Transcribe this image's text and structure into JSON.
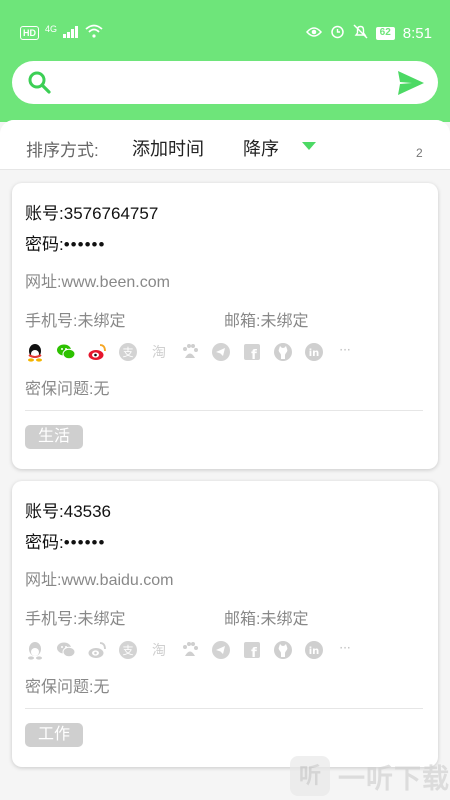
{
  "status_bar": {
    "hd": "HD",
    "network": "4G",
    "battery": "62",
    "time": "8:51"
  },
  "search": {
    "placeholder": ""
  },
  "sort": {
    "label": "排序方式:",
    "field": "添加时间",
    "order": "降序",
    "count": "2"
  },
  "accounts": [
    {
      "account_label": "账号:",
      "account": "3576764757",
      "password_label": "密码:",
      "password": "••••••",
      "site_label": "网址:",
      "site": "www.been.com",
      "phone_label": "手机号:",
      "phone": "未绑定",
      "email_label": "邮箱:",
      "email": "未绑定",
      "question_label": "密保问题:",
      "question": "无",
      "tag": "生活",
      "bound_icons_colored": true
    },
    {
      "account_label": "账号:",
      "account": "43536",
      "password_label": "密码:",
      "password": "••••••",
      "site_label": "网址:",
      "site": "www.baidu.com",
      "phone_label": "手机号:",
      "phone": "未绑定",
      "email_label": "邮箱:",
      "email": "未绑定",
      "question_label": "密保问题:",
      "question": "无",
      "tag": "工作",
      "bound_icons_colored": false
    }
  ],
  "platform_icons": [
    "qq-icon",
    "wechat-icon",
    "weibo-icon",
    "alipay-icon",
    "taobao-icon",
    "baidu-icon",
    "telegram-icon",
    "facebook-icon",
    "github-icon",
    "linkedin-icon",
    "more-icon"
  ],
  "icon_labels": {
    "alipay": "支",
    "taobao": "淘",
    "facebook": "f",
    "linkedin": "in",
    "more": "···"
  },
  "colors": {
    "accent": "#6ee57a",
    "caret": "#4cd964",
    "tag_bg": "#cfcfcf"
  },
  "watermark": {
    "logo": "听",
    "text": "一听下载"
  }
}
